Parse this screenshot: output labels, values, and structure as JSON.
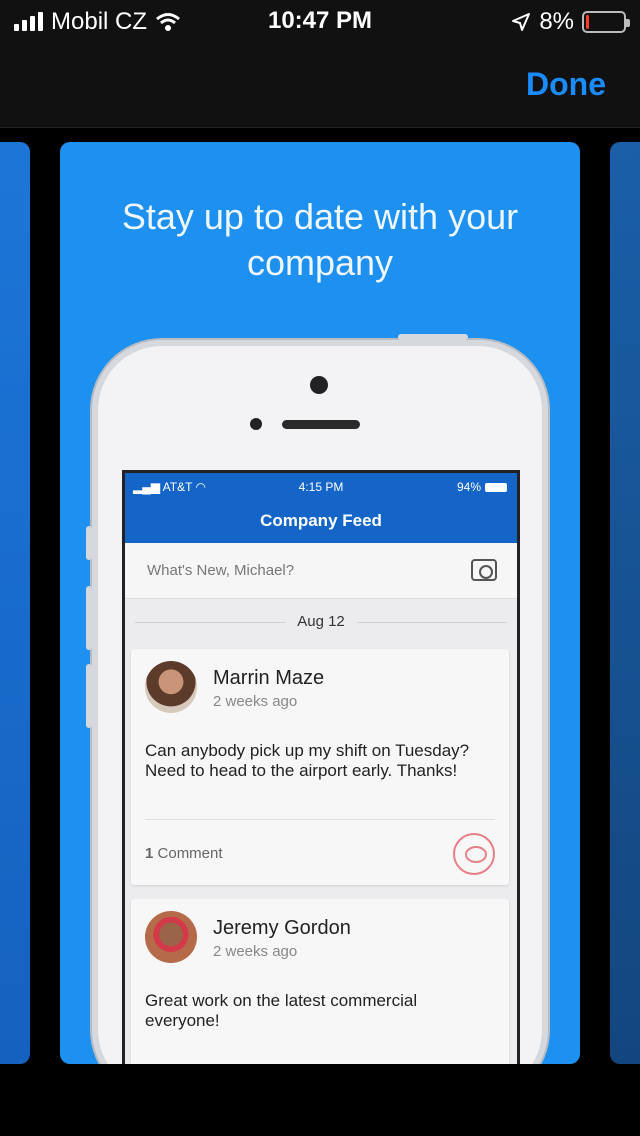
{
  "status_bar": {
    "carrier": "Mobil CZ",
    "time": "10:47 PM",
    "battery_percent": "8%",
    "battery_level": 0.08,
    "icons": [
      "signal-icon",
      "wifi-icon",
      "location-arrow-icon",
      "battery-icon"
    ]
  },
  "nav": {
    "done_label": "Done"
  },
  "carousel": {
    "headline": "Stay up to date with your company",
    "preview": {
      "status": {
        "carrier": "AT&T",
        "time": "4:15 PM",
        "battery": "94%"
      },
      "header_title": "Company Feed",
      "composer_placeholder": "What's New, Michael?",
      "date_label": "Aug 12",
      "posts": [
        {
          "name": "Marrin Maze",
          "time": "2 weeks ago",
          "body": "Can anybody pick up my shift on Tuesday? Need to head to the airport early. Thanks!",
          "comment_count": "1",
          "comment_label": "Comment"
        },
        {
          "name": "Jeremy Gordon",
          "time": "2 weeks ago",
          "body": "Great work on the latest commercial everyone!"
        }
      ]
    }
  },
  "colors": {
    "accent": "#1a8cff",
    "card_blue": "#1e90f0",
    "app_blue": "#1565c9",
    "battery_low": "#ff3b30"
  }
}
